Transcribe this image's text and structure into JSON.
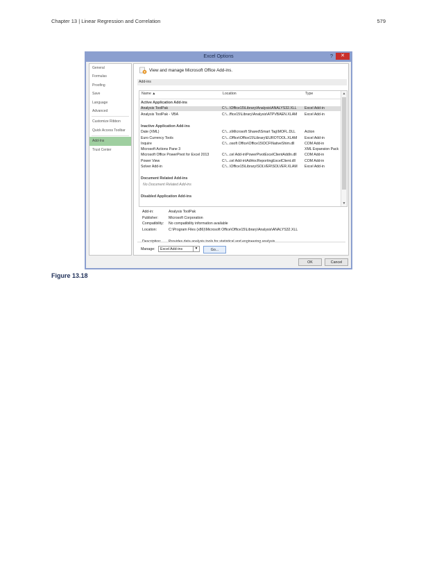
{
  "page_header": {
    "chapter": "Chapter 13 | Linear Regression and Correlation",
    "page_number": "579"
  },
  "dialog": {
    "title": "Excel Options",
    "help_glyph": "?",
    "close_glyph": "✕",
    "nav": [
      {
        "label": "General"
      },
      {
        "label": "Formulas"
      },
      {
        "label": "Proofing"
      },
      {
        "label": "Save"
      },
      {
        "label": "Language"
      },
      {
        "label": "Advanced"
      },
      {
        "label": "Customize Ribbon"
      },
      {
        "label": "Quick Access Toolbar"
      },
      {
        "label": "Add-Ins",
        "active": true
      },
      {
        "label": "Trust Center"
      }
    ],
    "header_text": "View and manage Microsoft Office Add-ins.",
    "section_label": "Add-ins",
    "columns": {
      "name": "Name ▲",
      "location": "Location",
      "type": "Type"
    },
    "groups": [
      {
        "title": "Active Application Add-ins",
        "rows": [
          {
            "name": "Analysis ToolPak",
            "location": "C:\\...\\Office15\\Library\\Analysis\\ANALYS32.XLL",
            "type": "Excel Add-in",
            "selected": true
          },
          {
            "name": "Analysis ToolPak - VBA",
            "location": "C:\\...ffice15\\Library\\Analysis\\ATPVBAEN.XLAM",
            "type": "Excel Add-in"
          }
        ]
      },
      {
        "title": "Inactive Application Add-ins",
        "rows": [
          {
            "name": "Date (XML)",
            "location": "C:\\...s\\Microsoft Shared\\Smart Tag\\MOFL.DLL",
            "type": "Action"
          },
          {
            "name": "Euro Currency Tools",
            "location": "C:\\...Office\\Office15\\Library\\EUROTOOL.XLAM",
            "type": "Excel Add-in"
          },
          {
            "name": "Inquire",
            "location": "C:\\...osoft Office\\Office15\\DCF\\NativeShim.dll",
            "type": "COM Add-in"
          },
          {
            "name": "Microsoft Actions Pane 3",
            "location": "",
            "type": "XML Expansion Pack"
          },
          {
            "name": "Microsoft Office PowerPivot for Excel 2013",
            "location": "C:\\...cel Add-in\\PowerPivotExcelClientAddIn.dll",
            "type": "COM Add-in"
          },
          {
            "name": "Power View",
            "location": "C:\\...cel Add-in\\AdHocReportingExcelClient.dll",
            "type": "COM Add-in"
          },
          {
            "name": "Solver Add-in",
            "location": "C:\\...\\Office15\\Library\\SOLVER\\SOLVER.XLAM",
            "type": "Excel Add-in"
          }
        ]
      },
      {
        "title": "Document Related Add-ins",
        "rows": [
          {
            "name": "No Document Related Add-ins",
            "location": "",
            "type": "",
            "italic": true
          }
        ]
      },
      {
        "title": "Disabled Application Add-ins",
        "rows": []
      }
    ],
    "details": [
      {
        "label": "Add-in:",
        "value": "Analysis ToolPak"
      },
      {
        "label": "Publisher:",
        "value": "Microsoft Corporation"
      },
      {
        "label": "Compatibility:",
        "value": "No compatibility information available"
      },
      {
        "label": "Location:",
        "value": "C:\\Program Files (x86)\\Microsoft Office\\Office15\\Library\\Analysis\\ANALYS32.XLL"
      },
      {
        "label": "Description:",
        "value": "Provides data analysis tools for statistical and engineering analysis"
      }
    ],
    "manage_label": "Manage:",
    "manage_value": "Excel Add-ins",
    "go_label": "Go...",
    "ok_label": "OK",
    "cancel_label": "Cancel"
  },
  "caption": "Figure 13.18",
  "colors": {
    "title_bar": "#8b9fcf",
    "close_button": "#c9302c",
    "nav_active": "#9fcfa0",
    "caption": "#1d2e57"
  }
}
